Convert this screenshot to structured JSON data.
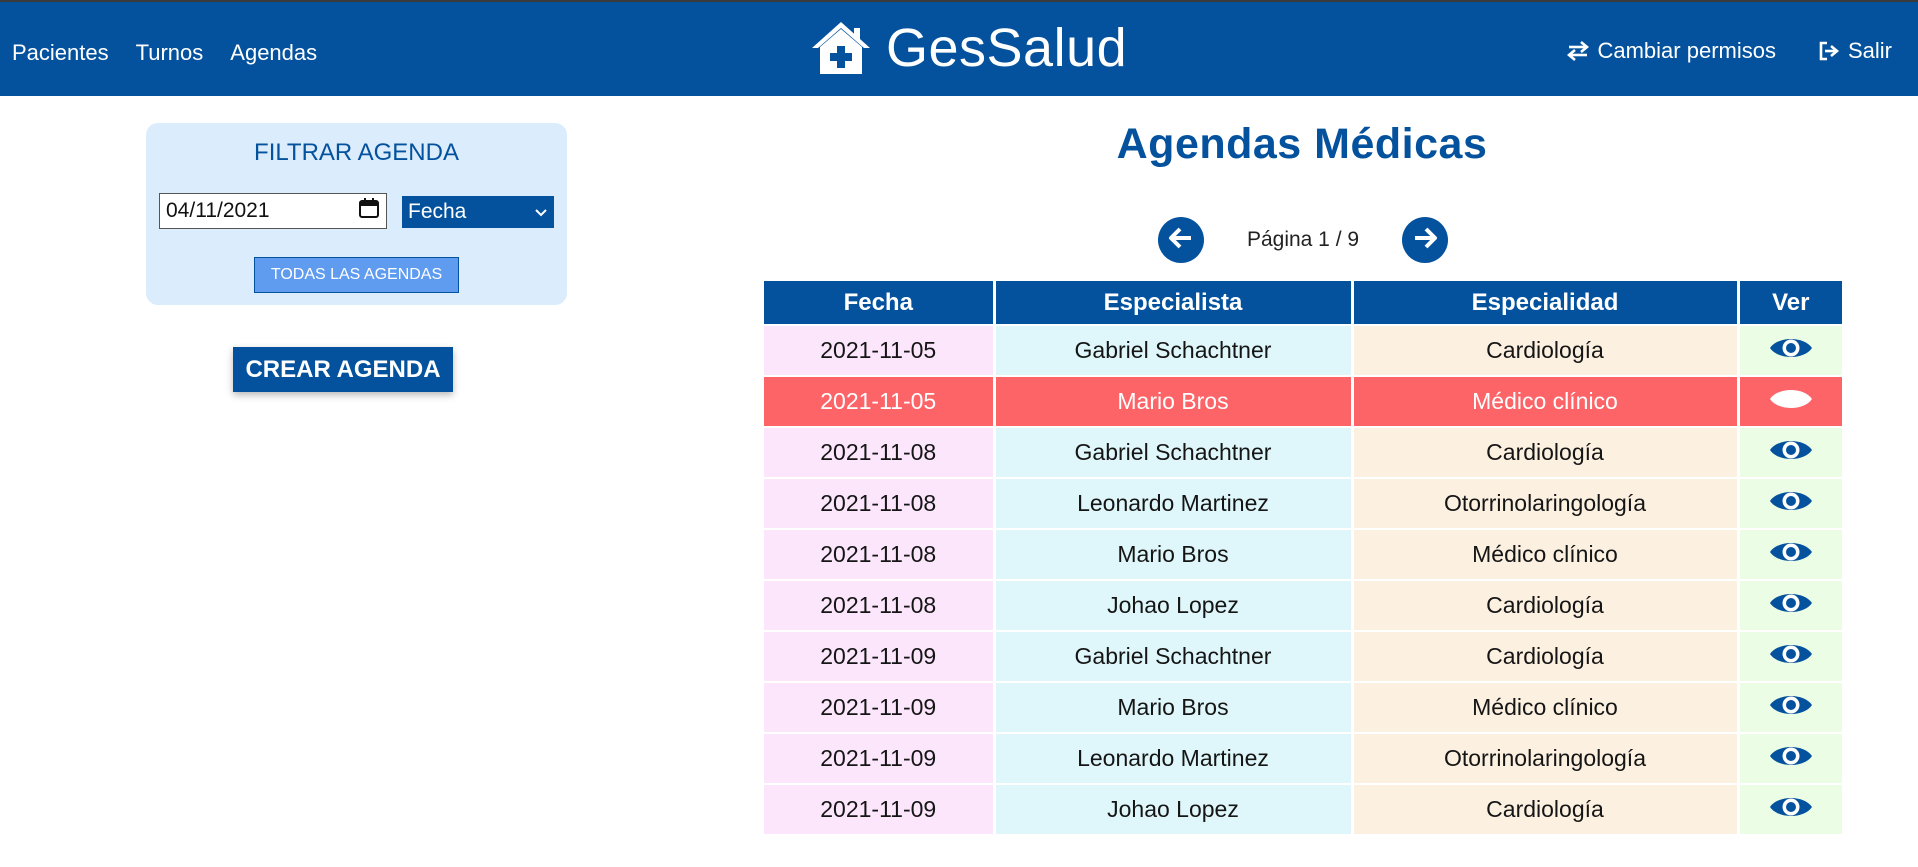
{
  "nav": {
    "links": [
      "Pacientes",
      "Turnos",
      "Agendas"
    ],
    "brand": "GesSalud",
    "cambiar_permisos": "Cambiar permisos",
    "salir": "Salir"
  },
  "filter": {
    "title": "FILTRAR AGENDA",
    "date_value": "04/11/2021",
    "select_value": "Fecha",
    "todas_label": "TODAS LAS AGENDAS"
  },
  "crear_label": "CREAR AGENDA",
  "main": {
    "title": "Agendas Médicas",
    "pagination": "Página 1 / 9"
  },
  "table": {
    "headers": [
      "Fecha",
      "Especialista",
      "Especialidad",
      "Ver"
    ],
    "rows": [
      {
        "fecha": "2021-11-05",
        "especialista": "Gabriel Schachtner",
        "especialidad": "Cardiología",
        "highlight": false
      },
      {
        "fecha": "2021-11-05",
        "especialista": "Mario Bros",
        "especialidad": "Médico clínico",
        "highlight": true
      },
      {
        "fecha": "2021-11-08",
        "especialista": "Gabriel Schachtner",
        "especialidad": "Cardiología",
        "highlight": false
      },
      {
        "fecha": "2021-11-08",
        "especialista": "Leonardo Martinez",
        "especialidad": "Otorrinolaringología",
        "highlight": false
      },
      {
        "fecha": "2021-11-08",
        "especialista": "Mario Bros",
        "especialidad": "Médico clínico",
        "highlight": false
      },
      {
        "fecha": "2021-11-08",
        "especialista": "Johao Lopez",
        "especialidad": "Cardiología",
        "highlight": false
      },
      {
        "fecha": "2021-11-09",
        "especialista": "Gabriel Schachtner",
        "especialidad": "Cardiología",
        "highlight": false
      },
      {
        "fecha": "2021-11-09",
        "especialista": "Mario Bros",
        "especialidad": "Médico clínico",
        "highlight": false
      },
      {
        "fecha": "2021-11-09",
        "especialista": "Leonardo Martinez",
        "especialidad": "Otorrinolaringología",
        "highlight": false
      },
      {
        "fecha": "2021-11-09",
        "especialista": "Johao Lopez",
        "especialidad": "Cardiología",
        "highlight": false
      }
    ]
  },
  "colors": {
    "primary": "#04529d",
    "highlight_row": "#fd6468",
    "filter_bg": "#dbecfc",
    "col_fecha": "#fbe6fb",
    "col_especialista": "#dff7fa",
    "col_especialidad": "#fcf0e1",
    "col_ver": "#ecfde6"
  },
  "icons": {
    "brand": "home-medical-icon",
    "cambiar_permisos": "exchange-icon",
    "salir": "sign-out-icon",
    "calendar": "calendar-icon",
    "select": "chevron-down-icon",
    "prev": "arrow-left-icon",
    "next": "arrow-right-icon",
    "ver": "eye-icon"
  }
}
